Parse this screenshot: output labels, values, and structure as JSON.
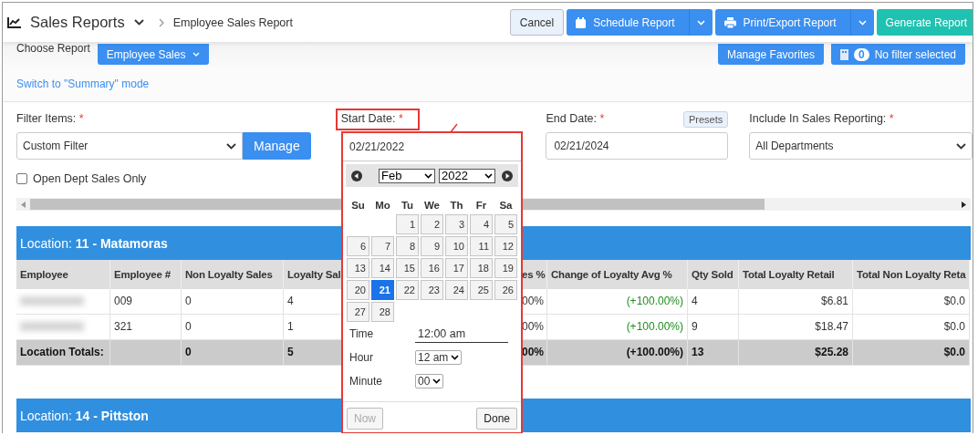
{
  "header": {
    "app_title": "Sales Reports",
    "breadcrumb": "Employee Sales Report",
    "buttons": [
      {
        "label": "Cancel",
        "kind": "plain"
      },
      {
        "label": "Schedule Report",
        "kind": "schedule"
      },
      {
        "label": "Print/Export Report",
        "kind": "print"
      },
      {
        "label": "Generate Report",
        "kind": "primary"
      }
    ]
  },
  "report_bar": {
    "label": "Choose Report",
    "report": "Employee Sales",
    "favorites": "Manage Favorites",
    "filter_count": "0",
    "filter_text": "No filter selected",
    "mode_link": "Switch to \"Summary\" mode"
  },
  "filters": {
    "filter_items": {
      "label": "Filter Items:",
      "mark": "*",
      "value": "Custom Filter",
      "button": "Manage"
    },
    "open_dept": {
      "label": "Open Dept Sales Only",
      "checked": false
    },
    "start_date": {
      "label": "Start Date:",
      "mark": "*",
      "value": "02/21/2022"
    },
    "end_date": {
      "label": "End Date:",
      "mark": "*",
      "value": "02/21/2024",
      "presets": "Presets"
    },
    "include": {
      "label": "Include In Sales Reporting:",
      "mark": "*",
      "value": "All Departments"
    }
  },
  "date_picker": {
    "month": "Feb",
    "year": "2022",
    "weekdays": [
      "Su",
      "Mo",
      "Tu",
      "We",
      "Th",
      "Fr",
      "Sa"
    ],
    "weeks": [
      [
        {
          "day": "1",
          "selected": false
        },
        {
          "day": "2",
          "selected": false
        },
        {
          "day": "3",
          "selected": false
        },
        {
          "day": "4",
          "selected": false
        },
        {
          "day": "5",
          "selected": false
        }
      ],
      [
        {
          "day": "6",
          "selected": false
        },
        {
          "day": "7",
          "selected": false
        },
        {
          "day": "8",
          "selected": false
        },
        {
          "day": "9",
          "selected": false
        },
        {
          "day": "10",
          "selected": false
        },
        {
          "day": "11",
          "selected": false
        },
        {
          "day": "12",
          "selected": false
        }
      ],
      [
        {
          "day": "13",
          "selected": false
        },
        {
          "day": "14",
          "selected": false
        },
        {
          "day": "15",
          "selected": false
        },
        {
          "day": "16",
          "selected": false
        },
        {
          "day": "17",
          "selected": false
        },
        {
          "day": "18",
          "selected": false
        },
        {
          "day": "19",
          "selected": false
        }
      ],
      [
        {
          "day": "20",
          "selected": false
        },
        {
          "day": "21",
          "selected": true
        },
        {
          "day": "22",
          "selected": false
        },
        {
          "day": "23",
          "selected": false
        },
        {
          "day": "24",
          "selected": false
        },
        {
          "day": "25",
          "selected": false
        },
        {
          "day": "26",
          "selected": false
        }
      ],
      [
        {
          "day": "27",
          "selected": false
        },
        {
          "day": "28",
          "selected": false
        }
      ]
    ],
    "time_label": "Time",
    "time": "12:00 am",
    "hour_label": "Hour",
    "hour": "12 am",
    "minute_label": "Minute",
    "minute": "00",
    "now": {
      "label": "Now",
      "disabled": true
    },
    "done": {
      "label": "Done",
      "disabled": false
    }
  },
  "sections": [
    {
      "title": "Location: **11 - Matamoras**",
      "columns": [
        "Employee",
        "Employee #",
        "Non Loyalty Sales",
        "Loyalty Sal",
        "es %",
        "Change of Loyalty Avg %",
        "Qty Sold",
        "Total Loyalty Retail",
        "Total Non Loyalty Reta"
      ],
      "rows": [
        {
          "kind": "employee",
          "blurred": true,
          "cells": [
            null,
            "009",
            "0",
            "4",
            "00%",
            "(+100.00%)",
            "4",
            "$6.81",
            "$0.0"
          ]
        },
        {
          "kind": "employee",
          "blurred": true,
          "cells": [
            null,
            "321",
            "0",
            "1",
            "00%",
            "(+100.00%)",
            "9",
            "$18.47",
            "$0.0"
          ]
        },
        {
          "kind": "total",
          "blurred": false,
          "cells": [
            "Location Totals:",
            null,
            "0",
            "5",
            "00%",
            "(+100.00%)",
            "13",
            "$25.28",
            "$0.0"
          ]
        }
      ]
    },
    {
      "title": "Location: **14 - Pittston**"
    }
  ]
}
